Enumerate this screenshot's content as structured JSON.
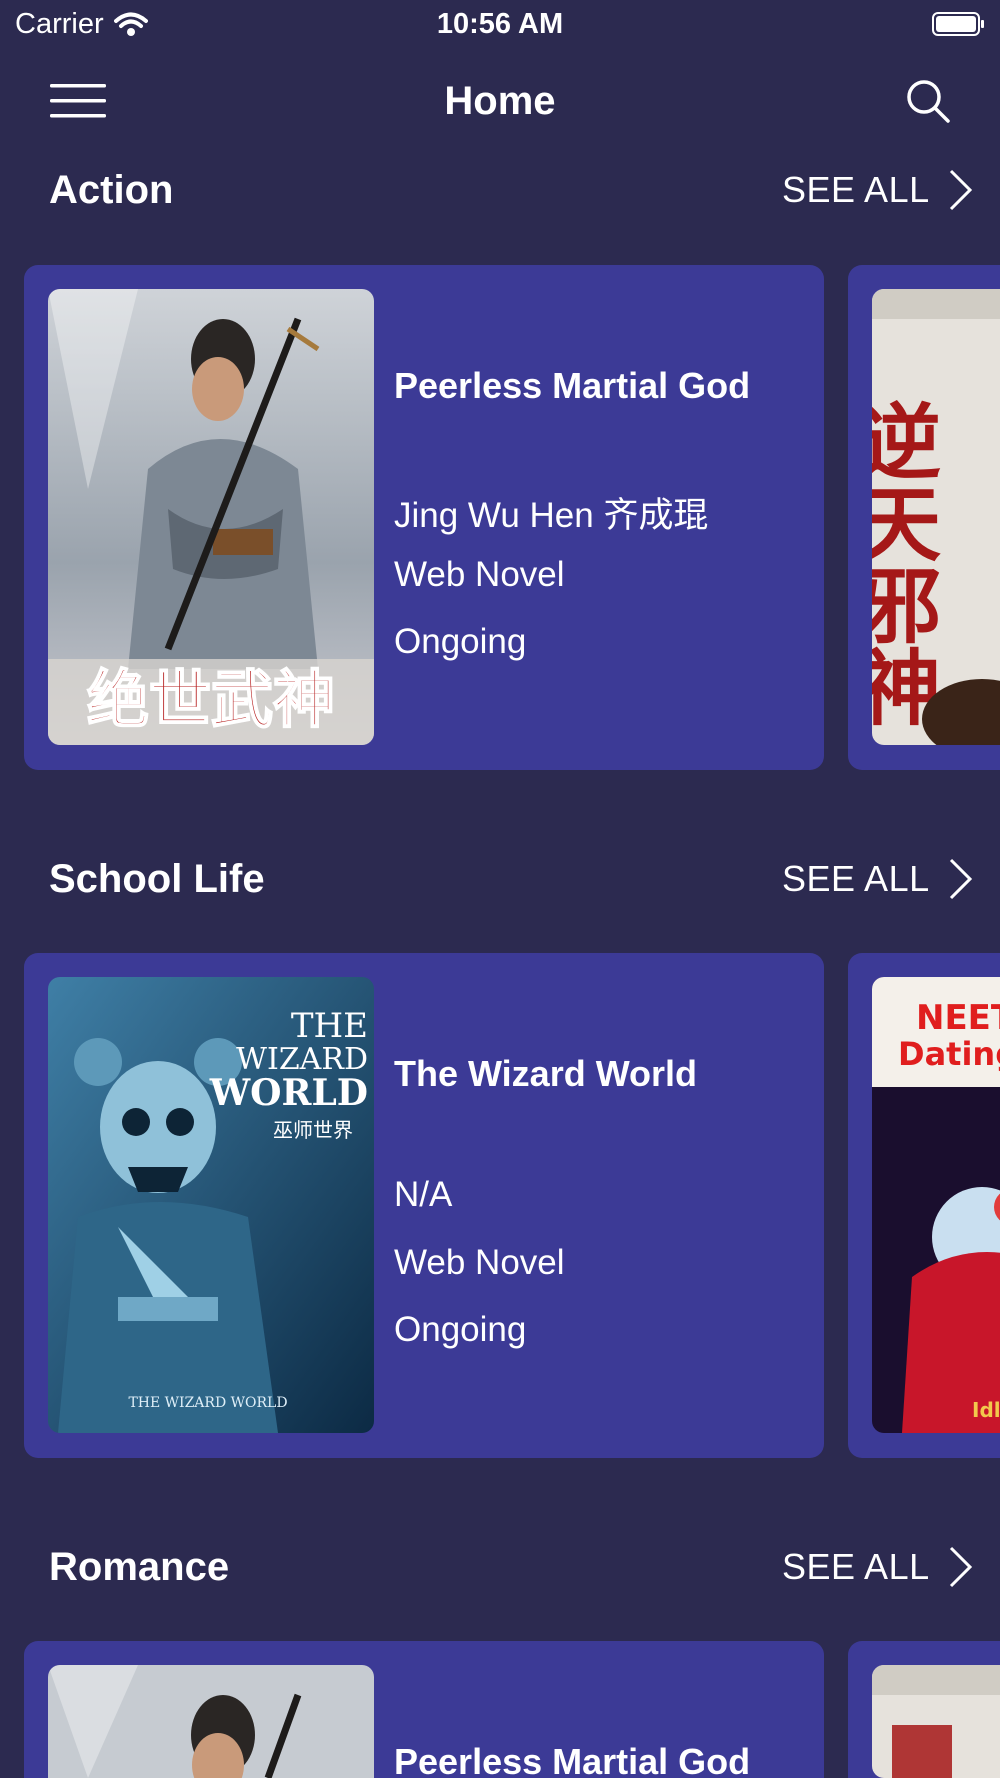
{
  "status_bar": {
    "carrier": "Carrier",
    "time": "10:56 AM"
  },
  "nav": {
    "title": "Home",
    "menu_icon": "hamburger-menu-icon",
    "search_icon": "search-icon"
  },
  "sections": [
    {
      "title": "Action",
      "see_all": "SEE ALL",
      "card": {
        "title": "Peerless Martial God",
        "author": "Jing Wu Hen 齐成琨",
        "type": "Web Novel",
        "status": "Ongoing",
        "cover_text": "绝世武神"
      },
      "peek_cover_text": "逆天邪神"
    },
    {
      "title": "School Life",
      "see_all": "SEE ALL",
      "card": {
        "title": "The Wizard World",
        "author": "N/A",
        "type": "Web Novel",
        "status": "Ongoing",
        "cover_text": "THE WIZARD WORLD",
        "cover_text_line1": "THE",
        "cover_text_line2": "WIZARD",
        "cover_text_line3": "WORLD",
        "cover_subtext": "巫师世界",
        "cover_footer": "THE WIZARD WORLD"
      },
      "peek_cover_text": "NEET Dating",
      "peek_line1": "NEET",
      "peek_line2": "Dating",
      "peek_bottom": "Idle"
    },
    {
      "title": "Romance",
      "see_all": "SEE ALL",
      "card": {
        "title": "Peerless Martial God"
      }
    }
  ],
  "colors": {
    "background": "#2c2a50",
    "card": "#3c3a96",
    "text": "#ffffff"
  }
}
